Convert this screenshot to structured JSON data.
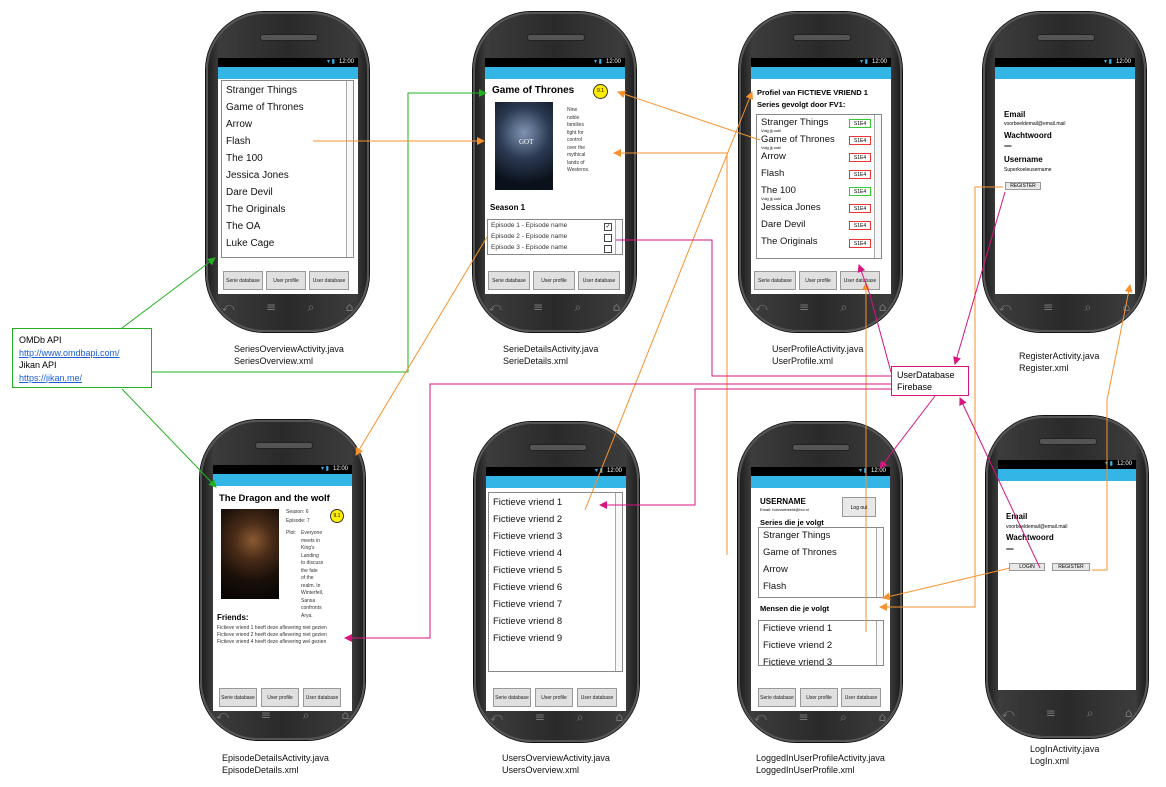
{
  "status_time": "12:00",
  "tabs": {
    "series": "Serie database",
    "profile": "User profile",
    "users": "User database"
  },
  "series_overview": {
    "items": [
      "Stranger Things",
      "Game of Thrones",
      "Arrow",
      "Flash",
      "The 100",
      "Jessica Jones",
      "Dare Devil",
      "The Originals",
      "The OA",
      "Luke Cage"
    ],
    "caption": "SeriesOverviewActivity.java\nSeriesOverview.xml"
  },
  "serie_details": {
    "title": "Game of Thrones",
    "rating": "9.1",
    "poster_text": "GOT",
    "description": "Nine\nnoble\nfamilies\nfight for\ncontrol\nover the\nmythical\nlands of\nWesteros.",
    "season": "Season 1",
    "episodes": [
      "Episode 1 - Episode name",
      "Episode 2 - Episode name",
      "Episode 3 - Episode name"
    ],
    "caption": "SerieDetailsActivity.java\nSerieDetails.xml"
  },
  "user_profile": {
    "title": "Profiel van FICTIEVE VRIEND 1",
    "subtitle": "Series gevolgt door FV1:",
    "sie_label": "S1E4",
    "note": "Volg jij ook!",
    "items": [
      "Stranger Things",
      "Game of Thrones",
      "Arrow",
      "Flash",
      "The 100",
      "Jessica Jones",
      "Dare Devil",
      "The Originals"
    ],
    "caption": "UserProfileActivity.java\nUserProfile.xml"
  },
  "register": {
    "email_label": "Email",
    "email_value": "voorbeeldemail@email.mail",
    "password_label": "Wachtwoord",
    "password_value": "•••••••••••••••••",
    "username_label": "Username",
    "username_value": "Superkoeleusername",
    "button": "REGISTER",
    "caption": "RegisterActivity.java\nRegister.xml"
  },
  "api_box": {
    "line1": "OMDb API",
    "link1": "http://www.omdbapi.com/",
    "line2": "Jikan API",
    "link2": "https://jikan.me/"
  },
  "userdb_box": {
    "line1": "UserDatabase",
    "line2": "Firebase"
  },
  "episode_details": {
    "title": "The Dragon and the wolf",
    "rating": "9.1",
    "season": "Season: 6",
    "episode": "Episode: 7",
    "plot_label": "Plot:",
    "plot": "Everyone\nmeets in\nKing's\nLanding\nto discuss\nthe fate\nof the\nrealm. In\nWinterfell,\nSansa\nconfronts\nArya.",
    "friends_label": "Friends:",
    "friends": [
      "Fictieve vriend 1 heeft deze aflevering niet gezien",
      "Fictieve vriend 2 heeft deze aflevering niet gezien",
      "Fictieve vriend 4 heeft deze aflevering wel gezien"
    ],
    "caption": "EpisodeDetailsActivity.java\nEpisodeDetails.xml"
  },
  "users_overview": {
    "items": [
      "Fictieve vriend 1",
      "Fictieve vriend 2",
      "Fictieve vriend 3",
      "Fictieve vriend 4",
      "Fictieve vriend 5",
      "Fictieve vriend 6",
      "Fictieve vriend 7",
      "Fictieve vriend 8",
      "Fictieve vriend 9"
    ],
    "caption": "UsersOverviewActivity.java\nUsersOverview.xml"
  },
  "logged_in_profile": {
    "username": "USERNAME",
    "email": "Email: hoivoorbeeld@hoi.nl",
    "logout": "Log out",
    "series_label": "Series die je volgt",
    "series": [
      "Stranger Things",
      "Game of Thrones",
      "Arrow",
      "Flash"
    ],
    "people_label": "Mensen die je volgt",
    "people": [
      "Fictieve vriend 1",
      "Fictieve vriend 2",
      "Fictieve vriend 3"
    ],
    "caption": "LoggedInUserProfileActivity.java\nLoggedInUserProfile.xml"
  },
  "login": {
    "email_label": "Email",
    "email_value": "voorbeeldemail@email.mail",
    "password_label": "Wachtwoord",
    "password_value": "•••••••••••••••••",
    "login_button": "LOGIN",
    "register_button": "REGISTER",
    "caption": "LogInActivity.java\nLogIn.xml"
  },
  "colors": {
    "accent": "#33b5e5",
    "green": "#22b022",
    "orange": "#f5922e",
    "magenta": "#d6157f",
    "star": "#ffee00"
  }
}
